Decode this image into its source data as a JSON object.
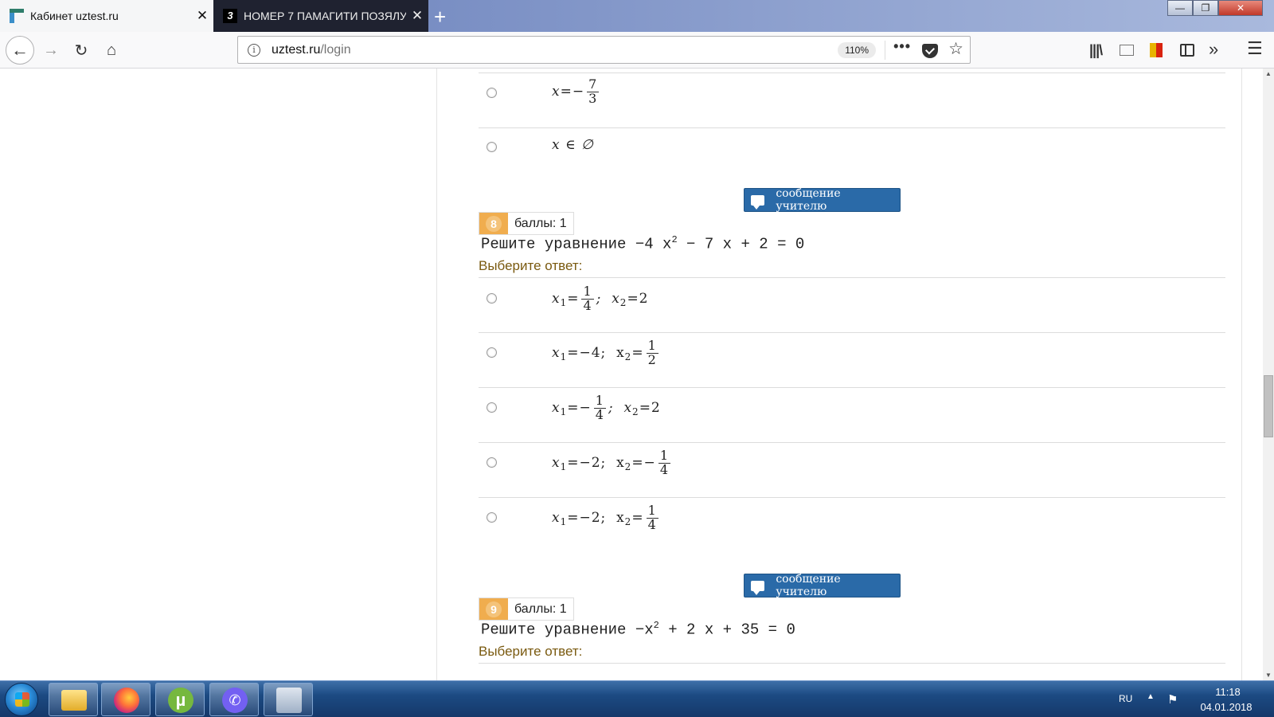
{
  "browser": {
    "tabs": [
      {
        "title": "Кабинет uztest.ru",
        "close": "✕"
      },
      {
        "title": "НОМЕР 7 ПАМАГИТИ ПОЗЯЛУ",
        "favicon_letter": "3",
        "close": "✕"
      }
    ],
    "new_tab": "+",
    "window_controls": {
      "minimize": "—",
      "maximize": "❐",
      "close": "✕"
    },
    "nav": {
      "back": "←",
      "forward": "→",
      "reload": "↻",
      "home": "⌂"
    },
    "url": {
      "host": "uztest.ru",
      "path": "/login"
    },
    "zoom": "110%",
    "icons": {
      "more": "•••",
      "star": "☆",
      "library": "|||\\",
      "overflow": "»",
      "menu": "☰",
      "info": "i"
    },
    "accent_colors": {
      "message_button": "#2a6aa8",
      "question_badge": "#f0ad4e"
    }
  },
  "page": {
    "prev_options": [
      {
        "prefix": "x=−",
        "num": "7",
        "den": "3"
      },
      {
        "text": "x ∈ ∅"
      }
    ],
    "questions": [
      {
        "message_button": "сообщение учителю",
        "number": "8",
        "points": "баллы: 1",
        "text_prefix": "Решите уравнение −4 x",
        "text_sup": "2",
        "text_suffix": " − 7 x + 2 = 0",
        "choose_label": "Выберите ответ:",
        "options": [
          {
            "p1": "x",
            "s1": "1",
            "e1": "=",
            "f1n": "1",
            "f1d": "4",
            "mid": ";  x",
            "s2": "2",
            "e2": "=2"
          },
          {
            "p1": "x",
            "s1": "1",
            "e1": "=−4;  x",
            "s2": "2",
            "e2": "=",
            "f2n": "1",
            "f2d": "2"
          },
          {
            "p1": "x",
            "s1": "1",
            "e1": "=−",
            "f1n": "1",
            "f1d": "4",
            "mid": ";  x",
            "s2": "2",
            "e2": "=2"
          },
          {
            "p1": "x",
            "s1": "1",
            "e1": "=−2;  x",
            "s2": "2",
            "e2": "=−",
            "f2n": "1",
            "f2d": "4"
          },
          {
            "p1": "x",
            "s1": "1",
            "e1": "=−2;  x",
            "s2": "2",
            "e2": "=",
            "f2n": "1",
            "f2d": "4"
          }
        ]
      },
      {
        "message_button": "сообщение учителю",
        "number": "9",
        "points": "баллы: 1",
        "text_prefix": "Решите уравнение −x",
        "text_sup": "2",
        "text_suffix": " + 2 x + 35 = 0",
        "choose_label": "Выберите ответ:"
      }
    ]
  },
  "taskbar": {
    "apps": [
      "explorer-icon",
      "firefox-icon",
      "utorrent-icon",
      "viber-icon",
      "calculator-icon"
    ],
    "lang": "RU",
    "time": "11:18",
    "date": "04.01.2018"
  }
}
